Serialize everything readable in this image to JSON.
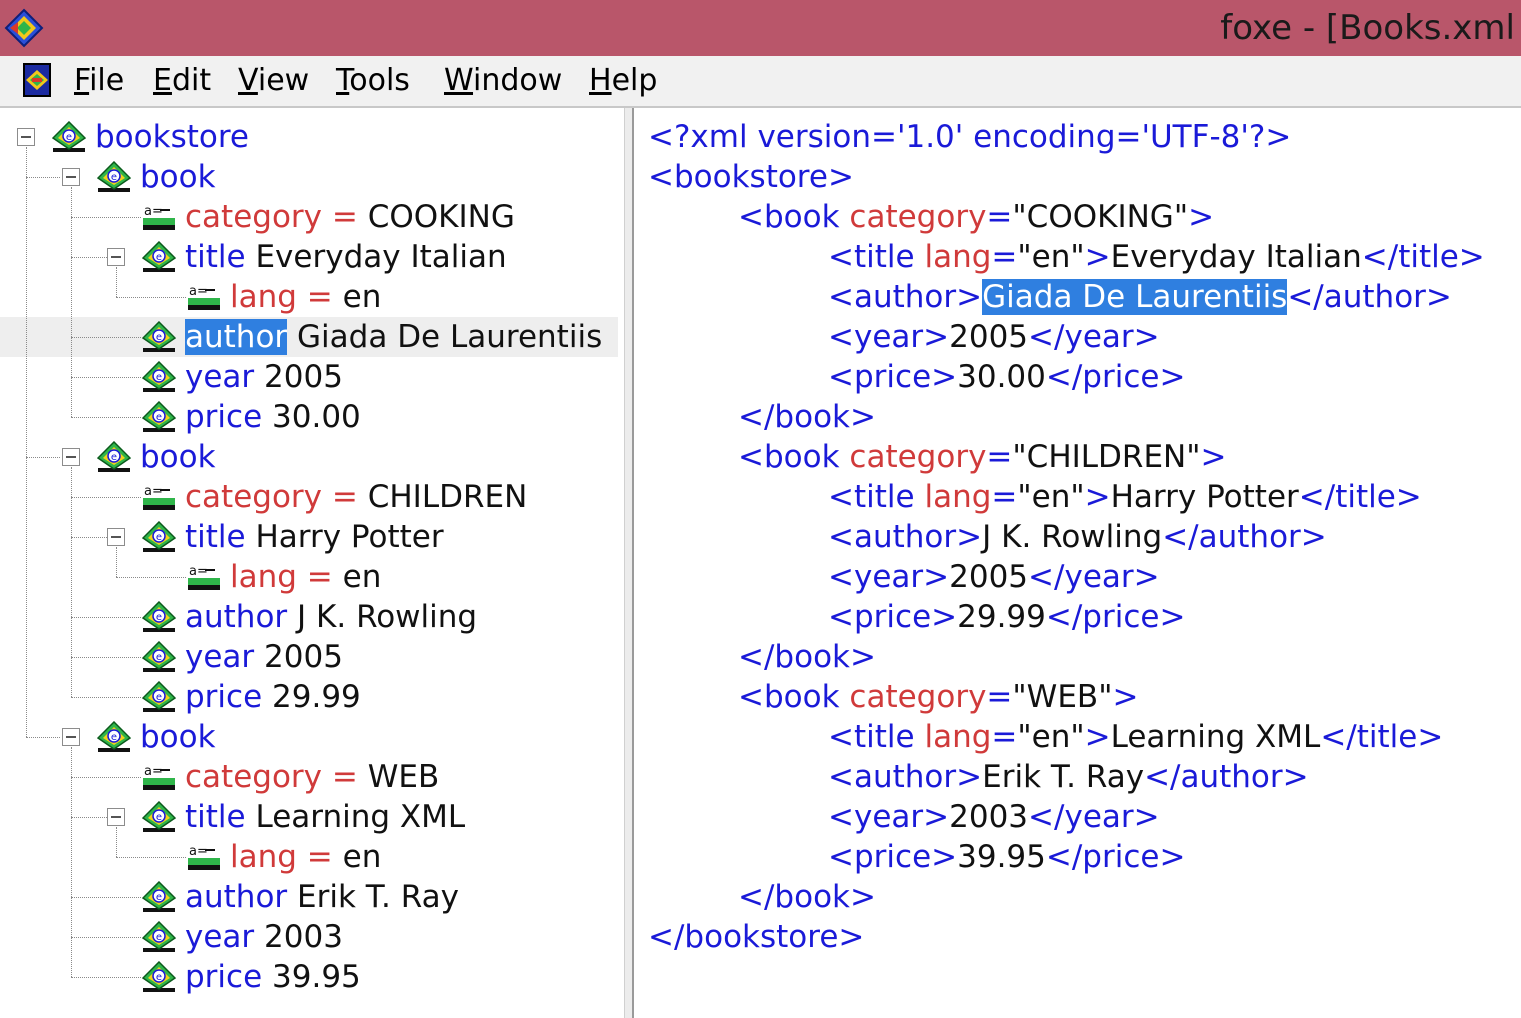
{
  "window": {
    "title": "foxe - [Books.xml"
  },
  "menu": [
    "File",
    "Edit",
    "View",
    "Tools",
    "Window",
    "Help"
  ],
  "tree": {
    "root": "bookstore",
    "books": [
      {
        "label": "book",
        "category_attr": "category",
        "category": "COOKING",
        "title_label": "title",
        "title": "Everyday Italian",
        "lang_attr": "lang",
        "lang": "en",
        "author_label": "author",
        "author": "Giada De Laurentiis",
        "year_label": "year",
        "year": "2005",
        "price_label": "price",
        "price": "30.00"
      },
      {
        "label": "book",
        "category_attr": "category",
        "category": "CHILDREN",
        "title_label": "title",
        "title": "Harry Potter",
        "lang_attr": "lang",
        "lang": "en",
        "author_label": "author",
        "author": "J K. Rowling",
        "year_label": "year",
        "year": "2005",
        "price_label": "price",
        "price": "29.99"
      },
      {
        "label": "book",
        "category_attr": "category",
        "category": "WEB",
        "title_label": "title",
        "title": "Learning XML",
        "lang_attr": "lang",
        "lang": "en",
        "author_label": "author",
        "author": "Erik T. Ray",
        "year_label": "year",
        "year": "2003",
        "price_label": "price",
        "price": "39.95"
      }
    ]
  },
  "xml": {
    "declaration": "<?xml version='1.0' encoding='UTF-8'?>",
    "root_open": "<bookstore>",
    "root_close": "</bookstore>"
  },
  "colors": {
    "titlebar": "#b9566a",
    "element": "#1a1ad8",
    "attribute": "#d03a3a",
    "selection": "#2f7fe0"
  }
}
